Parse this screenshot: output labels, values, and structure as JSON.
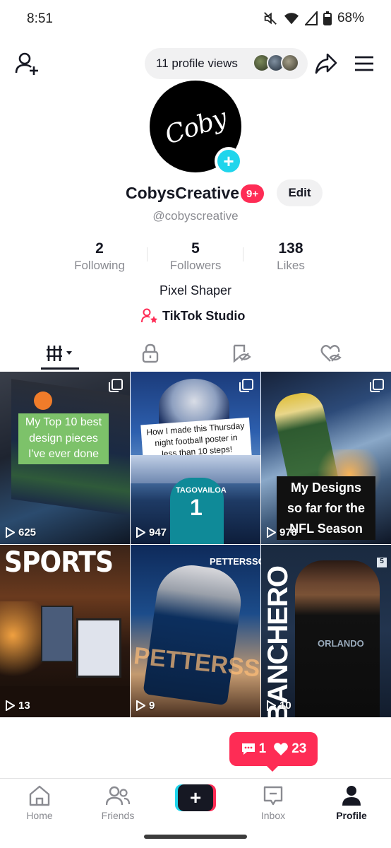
{
  "status_bar": {
    "time": "8:51",
    "battery": "68%",
    "icons": [
      "mute-icon",
      "wifi-icon",
      "signal-icon",
      "battery-icon"
    ]
  },
  "header": {
    "profile_views": "11 profile views"
  },
  "profile": {
    "display_name": "CobysCreative",
    "notification_badge": "9+",
    "edit_label": "Edit",
    "handle": "@cobyscreative",
    "avatar_text": "Coby",
    "bio": "Pixel Shaper",
    "studio_link": "TikTok Studio"
  },
  "stats": [
    {
      "value": "2",
      "label": "Following"
    },
    {
      "value": "5",
      "label": "Followers"
    },
    {
      "value": "138",
      "label": "Likes"
    }
  ],
  "tabs": [
    {
      "name": "videos",
      "icon": "grid-sort-icon",
      "active": true
    },
    {
      "name": "private",
      "icon": "lock-icon",
      "active": false
    },
    {
      "name": "reposts",
      "icon": "repost-eye-icon",
      "active": false
    },
    {
      "name": "liked",
      "icon": "liked-heart-icon",
      "active": false
    }
  ],
  "videos": [
    {
      "views": "625",
      "caption": "My Top 10 best design pieces I've ever done"
    },
    {
      "views": "947",
      "caption": "How I made this Thursday night football poster in less than 10 steps!",
      "sub": "TAGOVAILOA"
    },
    {
      "views": "978",
      "caption": "My Designs so far for the NFL Season"
    },
    {
      "views": "13",
      "caption": "SPORTS"
    },
    {
      "views": "9",
      "caption": "PETTERSSON"
    },
    {
      "views": "10",
      "caption": "BANCHERO"
    }
  ],
  "activity_popup": {
    "comments": "1",
    "likes": "23"
  },
  "bottom_nav": [
    {
      "label": "Home",
      "icon": "home-icon",
      "active": false
    },
    {
      "label": "Friends",
      "icon": "friends-icon",
      "active": false
    },
    {
      "label": "Inbox",
      "icon": "inbox-icon",
      "active": false
    },
    {
      "label": "Profile",
      "icon": "profile-icon",
      "active": true
    }
  ],
  "colors": {
    "accent_red": "#fe2c55",
    "accent_cyan": "#20d5ec",
    "text_primary": "#161823",
    "text_secondary": "#8a8b91",
    "caption_green": "#7dc26a"
  }
}
